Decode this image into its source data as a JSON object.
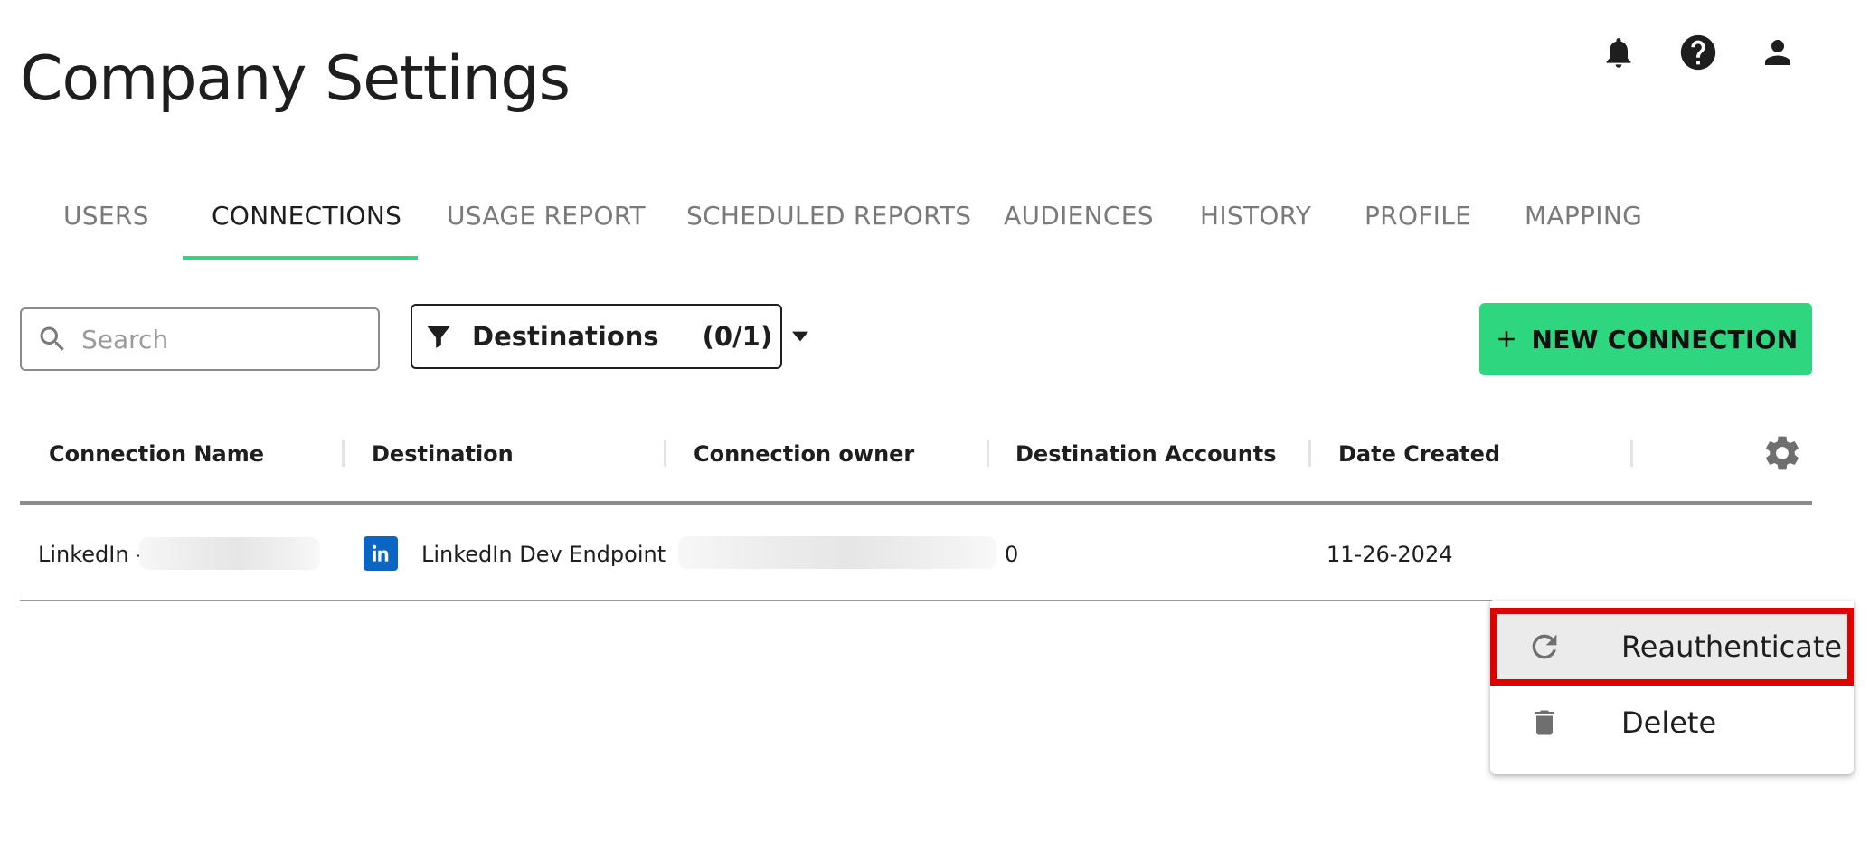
{
  "page": {
    "title": "Company Settings"
  },
  "header_icons": [
    "bell-icon",
    "help-icon",
    "account-icon"
  ],
  "tabs": [
    {
      "label": "USERS",
      "active": false
    },
    {
      "label": "CONNECTIONS",
      "active": true
    },
    {
      "label": "USAGE REPORT",
      "active": false
    },
    {
      "label": "SCHEDULED REPORTS",
      "active": false
    },
    {
      "label": "AUDIENCES",
      "active": false
    },
    {
      "label": "HISTORY",
      "active": false
    },
    {
      "label": "PROFILE",
      "active": false
    },
    {
      "label": "MAPPING",
      "active": false
    }
  ],
  "toolbar": {
    "search_placeholder": "Search",
    "filter_label": "Destinations",
    "filter_count": "(0/1)",
    "new_connection_label": "NEW CONNECTION"
  },
  "table": {
    "columns": [
      "Connection Name",
      "Destination",
      "Connection owner",
      "Destination Accounts",
      "Date Created"
    ],
    "rows": [
      {
        "connection_name": "LinkedIn -",
        "destination": "LinkedIn Dev Endpoint",
        "destination_accounts": "0",
        "date_created": "11-26-2024"
      }
    ]
  },
  "row_menu": {
    "items": [
      {
        "label": "Reauthenticate",
        "icon": "refresh-icon",
        "highlighted": true
      },
      {
        "label": "Delete",
        "icon": "trash-icon",
        "highlighted": false
      }
    ]
  },
  "colors": {
    "accent": "#2ed67f",
    "highlight_border": "#e00000",
    "linkedin": "#0a66c2"
  }
}
